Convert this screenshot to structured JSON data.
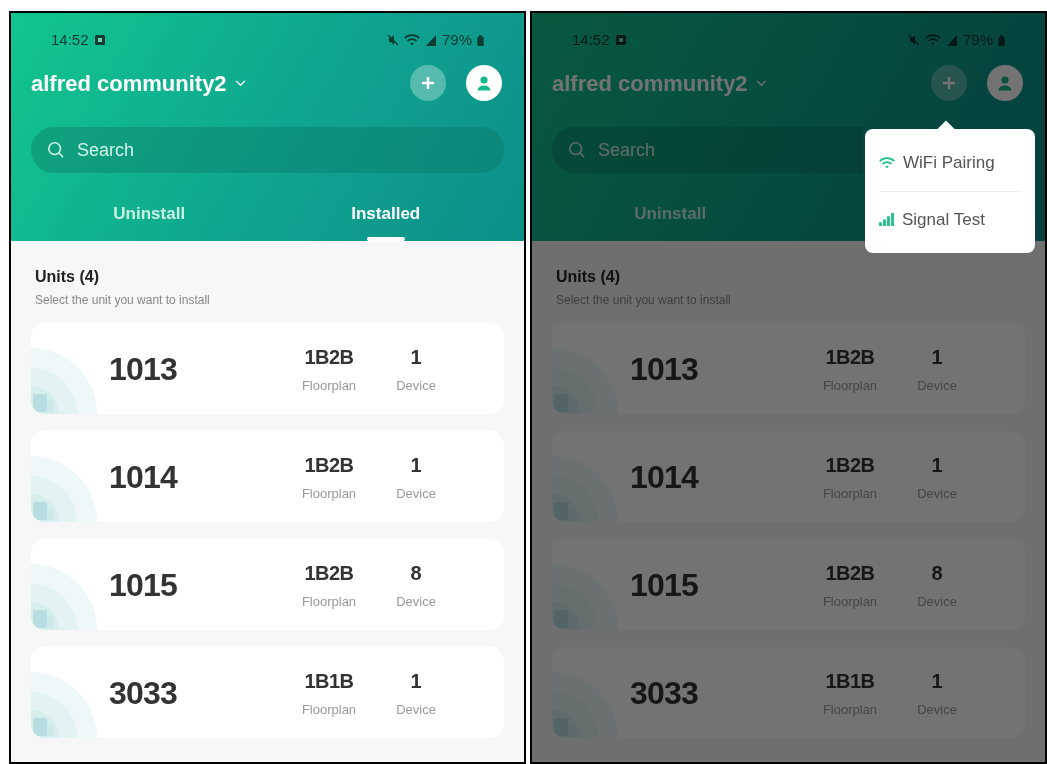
{
  "screens": [
    {
      "status_bar": {
        "time": "14:52",
        "battery": "79%"
      },
      "header": {
        "title": "alfred community2"
      },
      "search": {
        "placeholder": "Search"
      },
      "tabs": [
        {
          "label": "Uninstall",
          "selected": false
        },
        {
          "label": "Installed",
          "selected": true
        }
      ],
      "units": {
        "title": "Units (4)",
        "subtitle": "Select the unit you want to install",
        "items": [
          {
            "number": "1013",
            "floorplan": "1B2B",
            "floorplan_label": "Floorplan",
            "devices": "1",
            "devices_label": "Device"
          },
          {
            "number": "1014",
            "floorplan": "1B2B",
            "floorplan_label": "Floorplan",
            "devices": "1",
            "devices_label": "Device"
          },
          {
            "number": "1015",
            "floorplan": "1B2B",
            "floorplan_label": "Floorplan",
            "devices": "8",
            "devices_label": "Device"
          },
          {
            "number": "3033",
            "floorplan": "1B1B",
            "floorplan_label": "Floorplan",
            "devices": "1",
            "devices_label": "Device"
          }
        ]
      },
      "dimmed": false
    },
    {
      "status_bar": {
        "time": "14:52",
        "battery": "79%"
      },
      "header": {
        "title": "alfred community2"
      },
      "search": {
        "placeholder": "Search"
      },
      "tabs": [
        {
          "label": "Uninstall",
          "selected": false
        }
      ],
      "units": {
        "title": "Units (4)",
        "subtitle": "Select the unit you want to install",
        "items": [
          {
            "number": "1013",
            "floorplan": "1B2B",
            "floorplan_label": "Floorplan",
            "devices": "1",
            "devices_label": "Device"
          },
          {
            "number": "1014",
            "floorplan": "1B2B",
            "floorplan_label": "Floorplan",
            "devices": "1",
            "devices_label": "Device"
          },
          {
            "number": "1015",
            "floorplan": "1B2B",
            "floorplan_label": "Floorplan",
            "devices": "8",
            "devices_label": "Device"
          },
          {
            "number": "3033",
            "floorplan": "1B1B",
            "floorplan_label": "Floorplan",
            "devices": "1",
            "devices_label": "Device"
          }
        ]
      },
      "dimmed": true,
      "menu": {
        "items": [
          {
            "kind": "wifi",
            "label": "WiFi Pairing"
          },
          {
            "kind": "signal",
            "label": "Signal Test"
          }
        ]
      }
    }
  ]
}
